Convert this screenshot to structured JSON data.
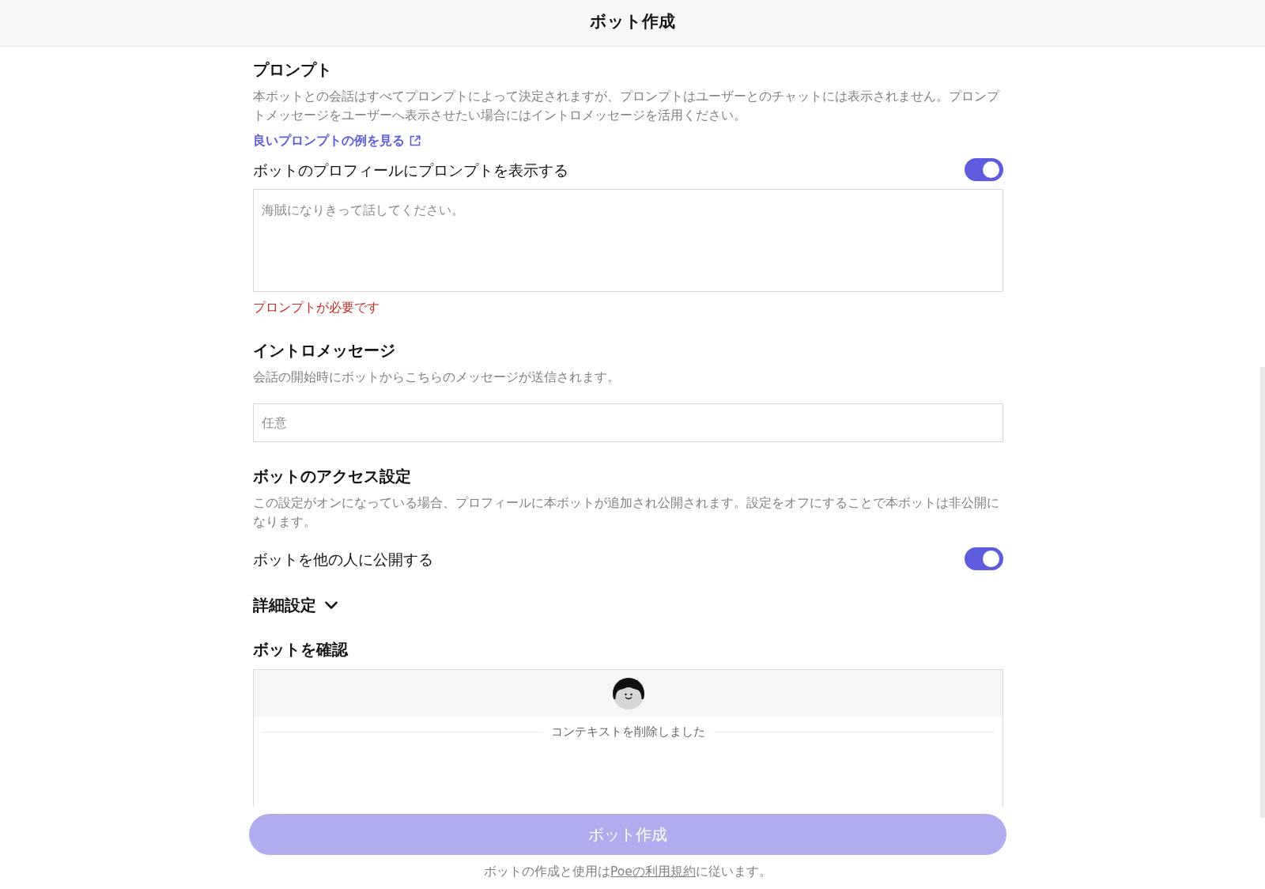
{
  "header": {
    "title": "ボット作成"
  },
  "prompt_section": {
    "heading": "プロンプト",
    "description": "本ボットとの会話はすべてプロンプトによって決定されますが、プロンプトはユーザーとのチャットには表示されません。プロンプトメッセージをユーザーへ表示させたい場合にはイントロメッセージを活用ください。",
    "link": {
      "label": "良いプロンプトの例を見る"
    },
    "show_in_profile": {
      "label": "ボットのプロフィールにプロンプトを表示する",
      "on": true
    },
    "prompt_field": {
      "placeholder": "海賊になりきって話してください。"
    },
    "error": "プロンプトが必要です"
  },
  "intro_section": {
    "heading": "イントロメッセージ",
    "description": "会話の開始時にボットからこちらのメッセージが送信されます。",
    "intro_field": {
      "placeholder": "任意"
    }
  },
  "access_section": {
    "heading": "ボットのアクセス設定",
    "description": "この設定がオンになっている場合、プロフィールに本ボットが追加され公開されます。設定をオフにすることで本ボットは非公開になります。",
    "public_toggle": {
      "label": "ボットを他の人に公開する",
      "on": true
    }
  },
  "advanced_settings": {
    "label": "詳細設定",
    "expanded": false
  },
  "preview_section": {
    "heading": "ボットを確認",
    "context_notice": "コンテキストを削除しました"
  },
  "footer": {
    "create_button": {
      "label": "ボット作成",
      "disabled": true
    },
    "terms": {
      "before": "ボットの作成と使用は",
      "link": "Poeの利用規約",
      "after": "に従います。"
    }
  }
}
